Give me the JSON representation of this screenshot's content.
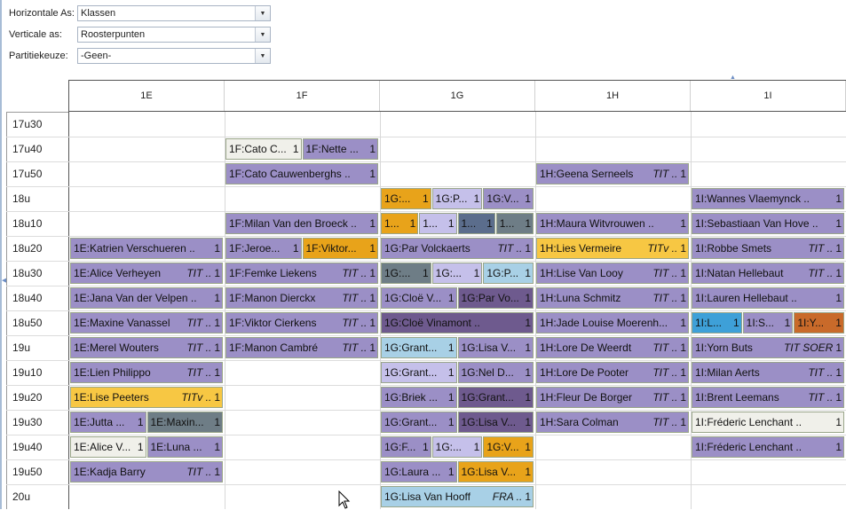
{
  "filters": [
    {
      "label": "Horizontale As:",
      "value": "Klassen"
    },
    {
      "label": "Verticale as:",
      "value": "Roosterpunten"
    },
    {
      "label": "Partitiekeuze:",
      "value": "-Geen-"
    }
  ],
  "columns": [
    "1E",
    "1F",
    "1G",
    "1H",
    "1I"
  ],
  "times": [
    "17u30",
    "17u40",
    "17u50",
    "18u",
    "18u10",
    "18u20",
    "18u30",
    "18u40",
    "18u50",
    "19u",
    "19u10",
    "19u20",
    "19u30",
    "19u40",
    "19u50",
    "20u"
  ],
  "colors": {
    "purple": "#9b8fc6",
    "orange": "#e8a31a",
    "yellow": "#f7c743",
    "lavender": "#c5c0ea",
    "lightblue": "#a8d0e6",
    "darkpurple": "#6e5a8e",
    "slate": "#6e7d86",
    "navy": "#5b6d8c",
    "white": "#f0f0ea",
    "brightblue": "#3ea0d8",
    "rust": "#c96a2a"
  },
  "cells": [
    {
      "col": 1,
      "sub": [
        0,
        2
      ],
      "row": 1,
      "text": "1F:Cato C...",
      "tag": "",
      "num": "1",
      "color": "white"
    },
    {
      "col": 1,
      "sub": [
        1,
        2
      ],
      "row": 1,
      "text": "1F:Nette ...",
      "tag": "",
      "num": "1",
      "color": "purple"
    },
    {
      "col": 1,
      "sub": [
        0,
        1
      ],
      "row": 2,
      "text": "1F:Cato Cauwenberghs ..",
      "tag": "",
      "num": "1",
      "color": "purple"
    },
    {
      "col": 3,
      "sub": [
        0,
        1
      ],
      "row": 2,
      "text": "1H:Geena Serneels",
      "tag": "TIT ..",
      "num": "1",
      "color": "purple"
    },
    {
      "col": 2,
      "sub": [
        0,
        3
      ],
      "row": 3,
      "text": "1G:...",
      "tag": "",
      "num": "1",
      "color": "orange"
    },
    {
      "col": 2,
      "sub": [
        1,
        3
      ],
      "row": 3,
      "text": "1G:P...",
      "tag": "",
      "num": "1",
      "color": "lavender"
    },
    {
      "col": 2,
      "sub": [
        2,
        3
      ],
      "row": 3,
      "text": "1G:V...",
      "tag": "",
      "num": "1",
      "color": "purple"
    },
    {
      "col": 4,
      "sub": [
        0,
        1
      ],
      "row": 3,
      "text": "1I:Wannes Vlaemynck ..",
      "tag": "",
      "num": "1",
      "color": "purple"
    },
    {
      "col": 1,
      "sub": [
        0,
        1
      ],
      "row": 4,
      "text": "1F:Milan Van den Broeck ..",
      "tag": "",
      "num": "1",
      "color": "purple"
    },
    {
      "col": 2,
      "sub": [
        0,
        4
      ],
      "row": 4,
      "text": "1...",
      "tag": "",
      "num": "1",
      "color": "orange"
    },
    {
      "col": 2,
      "sub": [
        1,
        4
      ],
      "row": 4,
      "text": "1...",
      "tag": "",
      "num": "1",
      "color": "lavender"
    },
    {
      "col": 2,
      "sub": [
        2,
        4
      ],
      "row": 4,
      "text": "1...",
      "tag": "",
      "num": "1",
      "color": "navy"
    },
    {
      "col": 2,
      "sub": [
        3,
        4
      ],
      "row": 4,
      "text": "1...",
      "tag": "",
      "num": "1",
      "color": "slate"
    },
    {
      "col": 3,
      "sub": [
        0,
        1
      ],
      "row": 4,
      "text": "1H:Maura Witvrouwen ..",
      "tag": "",
      "num": "1",
      "color": "purple"
    },
    {
      "col": 4,
      "sub": [
        0,
        1
      ],
      "row": 4,
      "text": "1I:Sebastiaan Van Hove ..",
      "tag": "",
      "num": "1",
      "color": "purple"
    },
    {
      "col": 0,
      "sub": [
        0,
        1
      ],
      "row": 5,
      "text": "1E:Katrien Verschueren ..",
      "tag": "",
      "num": "1",
      "color": "purple"
    },
    {
      "col": 1,
      "sub": [
        0,
        2
      ],
      "row": 5,
      "text": "1F:Jeroe...",
      "tag": "",
      "num": "1",
      "color": "purple"
    },
    {
      "col": 1,
      "sub": [
        1,
        2
      ],
      "row": 5,
      "text": "1F:Viktor...",
      "tag": "",
      "num": "1",
      "color": "orange"
    },
    {
      "col": 2,
      "sub": [
        0,
        1
      ],
      "row": 5,
      "text": "1G:Par Volckaerts",
      "tag": "TIT ..",
      "num": "1",
      "color": "purple"
    },
    {
      "col": 3,
      "sub": [
        0,
        1
      ],
      "row": 5,
      "text": "1H:Lies Vermeire",
      "tag": "TITv ..",
      "num": "1",
      "color": "yellow"
    },
    {
      "col": 4,
      "sub": [
        0,
        1
      ],
      "row": 5,
      "text": "1I:Robbe Smets",
      "tag": "TIT ..",
      "num": "1",
      "color": "purple"
    },
    {
      "col": 0,
      "sub": [
        0,
        1
      ],
      "row": 6,
      "text": "1E:Alice Verheyen",
      "tag": "TIT ..",
      "num": "1",
      "color": "purple"
    },
    {
      "col": 1,
      "sub": [
        0,
        1
      ],
      "row": 6,
      "text": "1F:Femke Liekens",
      "tag": "TIT ..",
      "num": "1",
      "color": "purple"
    },
    {
      "col": 2,
      "sub": [
        0,
        3
      ],
      "row": 6,
      "text": "1G:...",
      "tag": "",
      "num": "1",
      "color": "slate"
    },
    {
      "col": 2,
      "sub": [
        1,
        3
      ],
      "row": 6,
      "text": "1G:...",
      "tag": "",
      "num": "1",
      "color": "lavender"
    },
    {
      "col": 2,
      "sub": [
        2,
        3
      ],
      "row": 6,
      "text": "1G:P...",
      "tag": "",
      "num": "1",
      "color": "lightblue"
    },
    {
      "col": 3,
      "sub": [
        0,
        1
      ],
      "row": 6,
      "text": "1H:Lise Van Looy",
      "tag": "TIT ..",
      "num": "1",
      "color": "purple"
    },
    {
      "col": 4,
      "sub": [
        0,
        1
      ],
      "row": 6,
      "text": "1I:Natan Hellebaut",
      "tag": "TIT ..",
      "num": "1",
      "color": "purple"
    },
    {
      "col": 0,
      "sub": [
        0,
        1
      ],
      "row": 7,
      "text": "1E:Jana Van der Velpen ..",
      "tag": "",
      "num": "1",
      "color": "purple"
    },
    {
      "col": 1,
      "sub": [
        0,
        1
      ],
      "row": 7,
      "text": "1F:Manon Dierckx",
      "tag": "TIT ..",
      "num": "1",
      "color": "purple"
    },
    {
      "col": 2,
      "sub": [
        0,
        2
      ],
      "row": 7,
      "text": "1G:Cloë V...",
      "tag": "",
      "num": "1",
      "color": "purple"
    },
    {
      "col": 2,
      "sub": [
        1,
        2
      ],
      "row": 7,
      "text": "1G:Par Vo...",
      "tag": "",
      "num": "1",
      "color": "darkpurple"
    },
    {
      "col": 3,
      "sub": [
        0,
        1
      ],
      "row": 7,
      "text": "1H:Luna Schmitz",
      "tag": "TIT ..",
      "num": "1",
      "color": "purple"
    },
    {
      "col": 4,
      "sub": [
        0,
        1
      ],
      "row": 7,
      "text": "1I:Lauren Hellebaut ..",
      "tag": "",
      "num": "1",
      "color": "purple"
    },
    {
      "col": 0,
      "sub": [
        0,
        1
      ],
      "row": 8,
      "text": "1E:Maxine Vanassel",
      "tag": "TIT ..",
      "num": "1",
      "color": "purple"
    },
    {
      "col": 1,
      "sub": [
        0,
        1
      ],
      "row": 8,
      "text": "1F:Viktor Cierkens",
      "tag": "TIT ..",
      "num": "1",
      "color": "purple"
    },
    {
      "col": 2,
      "sub": [
        0,
        1
      ],
      "row": 8,
      "text": "1G:Cloë Vinamont ..",
      "tag": "",
      "num": "1",
      "color": "darkpurple"
    },
    {
      "col": 3,
      "sub": [
        0,
        1
      ],
      "row": 8,
      "text": "1H:Jade Louise Moerenh...",
      "tag": "",
      "num": "1",
      "color": "purple"
    },
    {
      "col": 4,
      "sub": [
        0,
        3
      ],
      "row": 8,
      "text": "1I:L...",
      "tag": "",
      "num": "1",
      "color": "brightblue"
    },
    {
      "col": 4,
      "sub": [
        1,
        3
      ],
      "row": 8,
      "text": "1I:S...",
      "tag": "",
      "num": "1",
      "color": "purple"
    },
    {
      "col": 4,
      "sub": [
        2,
        3
      ],
      "row": 8,
      "text": "1I:Y...",
      "tag": "",
      "num": "1",
      "color": "rust"
    },
    {
      "col": 0,
      "sub": [
        0,
        1
      ],
      "row": 9,
      "text": "1E:Merel Wouters",
      "tag": "TIT ..",
      "num": "1",
      "color": "purple"
    },
    {
      "col": 1,
      "sub": [
        0,
        1
      ],
      "row": 9,
      "text": "1F:Manon Cambré",
      "tag": "TIT ..",
      "num": "1",
      "color": "purple"
    },
    {
      "col": 2,
      "sub": [
        0,
        2
      ],
      "row": 9,
      "text": "1G:Grant...",
      "tag": "",
      "num": "1",
      "color": "lightblue"
    },
    {
      "col": 2,
      "sub": [
        1,
        2
      ],
      "row": 9,
      "text": "1G:Lisa V...",
      "tag": "",
      "num": "1",
      "color": "purple"
    },
    {
      "col": 3,
      "sub": [
        0,
        1
      ],
      "row": 9,
      "text": "1H:Lore De Weerdt",
      "tag": "TIT ..",
      "num": "1",
      "color": "purple"
    },
    {
      "col": 4,
      "sub": [
        0,
        1
      ],
      "row": 9,
      "text": "1I:Yorn Buts",
      "tag": "TIT   SOER",
      "num": "1",
      "color": "purple"
    },
    {
      "col": 0,
      "sub": [
        0,
        1
      ],
      "row": 10,
      "text": "1E:Lien Philippo",
      "tag": "TIT ..",
      "num": "1",
      "color": "purple"
    },
    {
      "col": 2,
      "sub": [
        0,
        2
      ],
      "row": 10,
      "text": "1G:Grant...",
      "tag": "",
      "num": "1",
      "color": "lavender"
    },
    {
      "col": 2,
      "sub": [
        1,
        2
      ],
      "row": 10,
      "text": "1G:Nel D...",
      "tag": "",
      "num": "1",
      "color": "purple"
    },
    {
      "col": 3,
      "sub": [
        0,
        1
      ],
      "row": 10,
      "text": "1H:Lore De Pooter",
      "tag": "TIT ..",
      "num": "1",
      "color": "purple"
    },
    {
      "col": 4,
      "sub": [
        0,
        1
      ],
      "row": 10,
      "text": "1I:Milan Aerts",
      "tag": "TIT ..",
      "num": "1",
      "color": "purple"
    },
    {
      "col": 0,
      "sub": [
        0,
        1
      ],
      "row": 11,
      "text": "1E:Lise Peeters",
      "tag": "TITv ..",
      "num": "1",
      "color": "yellow"
    },
    {
      "col": 2,
      "sub": [
        0,
        2
      ],
      "row": 11,
      "text": "1G:Briek ...",
      "tag": "",
      "num": "1",
      "color": "purple"
    },
    {
      "col": 2,
      "sub": [
        1,
        2
      ],
      "row": 11,
      "text": "1G:Grant...",
      "tag": "",
      "num": "1",
      "color": "darkpurple"
    },
    {
      "col": 3,
      "sub": [
        0,
        1
      ],
      "row": 11,
      "text": "1H:Fleur De Borger",
      "tag": "TIT ..",
      "num": "1",
      "color": "purple"
    },
    {
      "col": 4,
      "sub": [
        0,
        1
      ],
      "row": 11,
      "text": "1I:Brent Leemans",
      "tag": "TIT ..",
      "num": "1",
      "color": "purple"
    },
    {
      "col": 0,
      "sub": [
        0,
        2
      ],
      "row": 12,
      "text": "1E:Jutta ...",
      "tag": "",
      "num": "1",
      "color": "purple"
    },
    {
      "col": 0,
      "sub": [
        1,
        2
      ],
      "row": 12,
      "text": "1E:Maxin...",
      "tag": "",
      "num": "1",
      "color": "slate"
    },
    {
      "col": 2,
      "sub": [
        0,
        2
      ],
      "row": 12,
      "text": "1G:Grant...",
      "tag": "",
      "num": "1",
      "color": "purple"
    },
    {
      "col": 2,
      "sub": [
        1,
        2
      ],
      "row": 12,
      "text": "1G:Lisa V...",
      "tag": "",
      "num": "1",
      "color": "darkpurple"
    },
    {
      "col": 3,
      "sub": [
        0,
        1
      ],
      "row": 12,
      "text": "1H:Sara Colman",
      "tag": "TIT ..",
      "num": "1",
      "color": "purple"
    },
    {
      "col": 4,
      "sub": [
        0,
        1
      ],
      "row": 12,
      "text": "1I:Fréderic Lenchant ..",
      "tag": "",
      "num": "1",
      "color": "white"
    },
    {
      "col": 0,
      "sub": [
        0,
        2
      ],
      "row": 13,
      "text": "1E:Alice V...",
      "tag": "",
      "num": "1",
      "color": "white"
    },
    {
      "col": 0,
      "sub": [
        1,
        2
      ],
      "row": 13,
      "text": "1E:Luna ...",
      "tag": "",
      "num": "1",
      "color": "purple"
    },
    {
      "col": 2,
      "sub": [
        0,
        3
      ],
      "row": 13,
      "text": "1G:F...",
      "tag": "",
      "num": "1",
      "color": "purple"
    },
    {
      "col": 2,
      "sub": [
        1,
        3
      ],
      "row": 13,
      "text": "1G:...",
      "tag": "",
      "num": "1",
      "color": "lavender"
    },
    {
      "col": 2,
      "sub": [
        2,
        3
      ],
      "row": 13,
      "text": "1G:V...",
      "tag": "",
      "num": "1",
      "color": "orange"
    },
    {
      "col": 4,
      "sub": [
        0,
        1
      ],
      "row": 13,
      "text": "1I:Fréderic Lenchant ..",
      "tag": "",
      "num": "1",
      "color": "purple"
    },
    {
      "col": 0,
      "sub": [
        0,
        1
      ],
      "row": 14,
      "text": "1E:Kadja Barry",
      "tag": "TIT ..",
      "num": "1",
      "color": "purple"
    },
    {
      "col": 2,
      "sub": [
        0,
        2
      ],
      "row": 14,
      "text": "1G:Laura ...",
      "tag": "",
      "num": "1",
      "color": "purple"
    },
    {
      "col": 2,
      "sub": [
        1,
        2
      ],
      "row": 14,
      "text": "1G:Lisa V...",
      "tag": "",
      "num": "1",
      "color": "orange"
    },
    {
      "col": 2,
      "sub": [
        0,
        1
      ],
      "row": 15,
      "text": "1G:Lisa Van Hooff",
      "tag": "FRA ..",
      "num": "1",
      "color": "lightblue"
    }
  ]
}
